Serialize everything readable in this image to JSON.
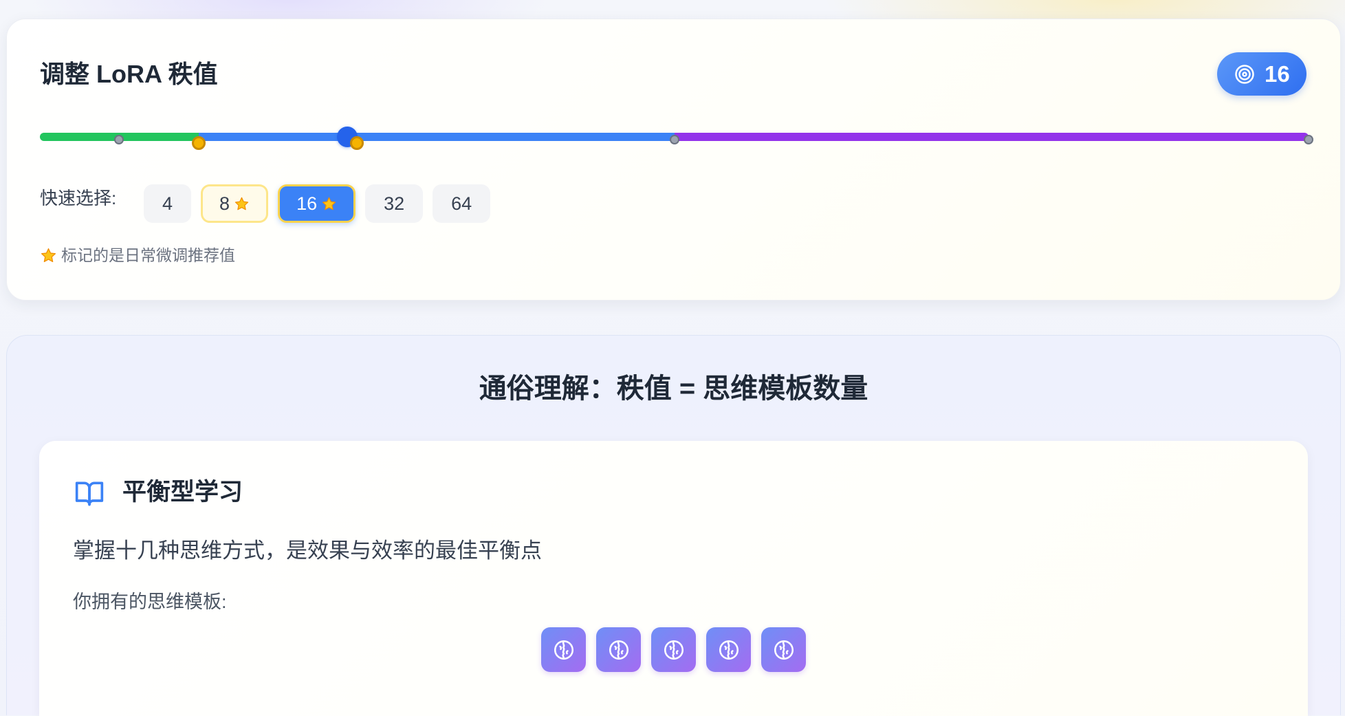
{
  "slider_panel": {
    "title": "调整 LoRA 秩值",
    "current_value_badge": {
      "icon": "target-icon",
      "value": "16"
    },
    "slider": {
      "min": 0,
      "max": 64,
      "value": 16,
      "segments": [
        {
          "from": 0,
          "to": 8,
          "color": "#22c55e"
        },
        {
          "from": 8,
          "to": 32,
          "color": "#3b82f6"
        },
        {
          "from": 32,
          "to": 64,
          "color": "#9333ea"
        }
      ],
      "marks": [
        {
          "value": 4,
          "recommended": false
        },
        {
          "value": 8,
          "recommended": true
        },
        {
          "value": 16,
          "recommended": true
        },
        {
          "value": 32,
          "recommended": false
        },
        {
          "value": 64,
          "recommended": false
        }
      ],
      "thumb_color": "#2563eb",
      "recommended_mark_color": "#f5b301",
      "normal_mark_color": "#9ca3af"
    },
    "quick_select": {
      "label": "快速选择:",
      "selected": "16",
      "options": [
        {
          "label": "4",
          "recommended": false
        },
        {
          "label": "8",
          "recommended": true
        },
        {
          "label": "16",
          "recommended": true
        },
        {
          "label": "32",
          "recommended": false
        },
        {
          "label": "64",
          "recommended": false
        }
      ]
    },
    "note": {
      "icon": "star-icon",
      "text": "标记的是日常微调推荐值"
    }
  },
  "explanation_panel": {
    "title": "通俗理解：秩值 = 思维模板数量",
    "card": {
      "icon": "book-open-icon",
      "heading": "平衡型学习",
      "description": "掌握十几种思维方式，是效果与效率的最佳平衡点",
      "templates_label": "你拥有的思维模板:",
      "template_icon": "brain-icon",
      "template_count": 5
    }
  }
}
